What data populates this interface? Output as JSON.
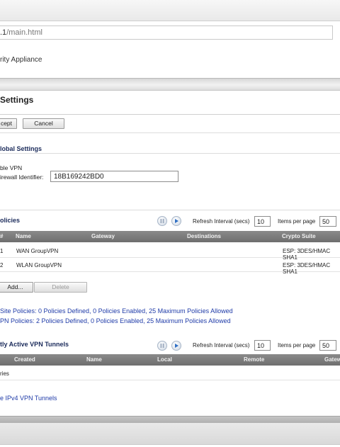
{
  "browser": {
    "address_prefix": ".1",
    "address_path": "/main.html"
  },
  "header": {
    "appliance_text": "rity Appliance"
  },
  "page": {
    "title": "Settings",
    "accept_label": "cept",
    "cancel_label": "Cancel"
  },
  "global_settings": {
    "title": "lobal Settings",
    "enable_vpn_label": "ble VPN",
    "firewall_id_label": "irewall Identifier:",
    "firewall_id_value": "18B169242BD0"
  },
  "policies": {
    "title": "olicies",
    "refresh_label": "Refresh Interval (secs)",
    "refresh_value": "10",
    "items_label": "Items per page",
    "items_value": "50",
    "columns": [
      "#",
      "Name",
      "Gateway",
      "Destinations",
      "Crypto Suite"
    ],
    "rows": [
      {
        "num": "1",
        "name": "WAN GroupVPN",
        "gateway": "",
        "destinations": "",
        "crypto": "ESP: 3DES/HMAC SHA1"
      },
      {
        "num": "2",
        "name": "WLAN GroupVPN",
        "gateway": "",
        "destinations": "",
        "crypto": "ESP: 3DES/HMAC SHA1"
      }
    ],
    "add_label": "Add...",
    "delete_label": "Delete",
    "summary_site": "Site Policies: 0 Policies Defined, 0 Policies Enabled, 25 Maximum Policies Allowed",
    "summary_gvpn": "PN Policies: 2 Policies Defined, 0 Policies Enabled, 25 Maximum Policies Allowed"
  },
  "tunnels": {
    "title": "tly Active VPN Tunnels",
    "refresh_label": "Refresh Interval (secs)",
    "refresh_value": "10",
    "items_label": "Items per page",
    "items_value": "50",
    "columns": [
      "Created",
      "Name",
      "Local",
      "Remote",
      "Gatew"
    ],
    "empty_text": "ries",
    "ipv4_link": "e IPv4 VPN Tunnels"
  }
}
